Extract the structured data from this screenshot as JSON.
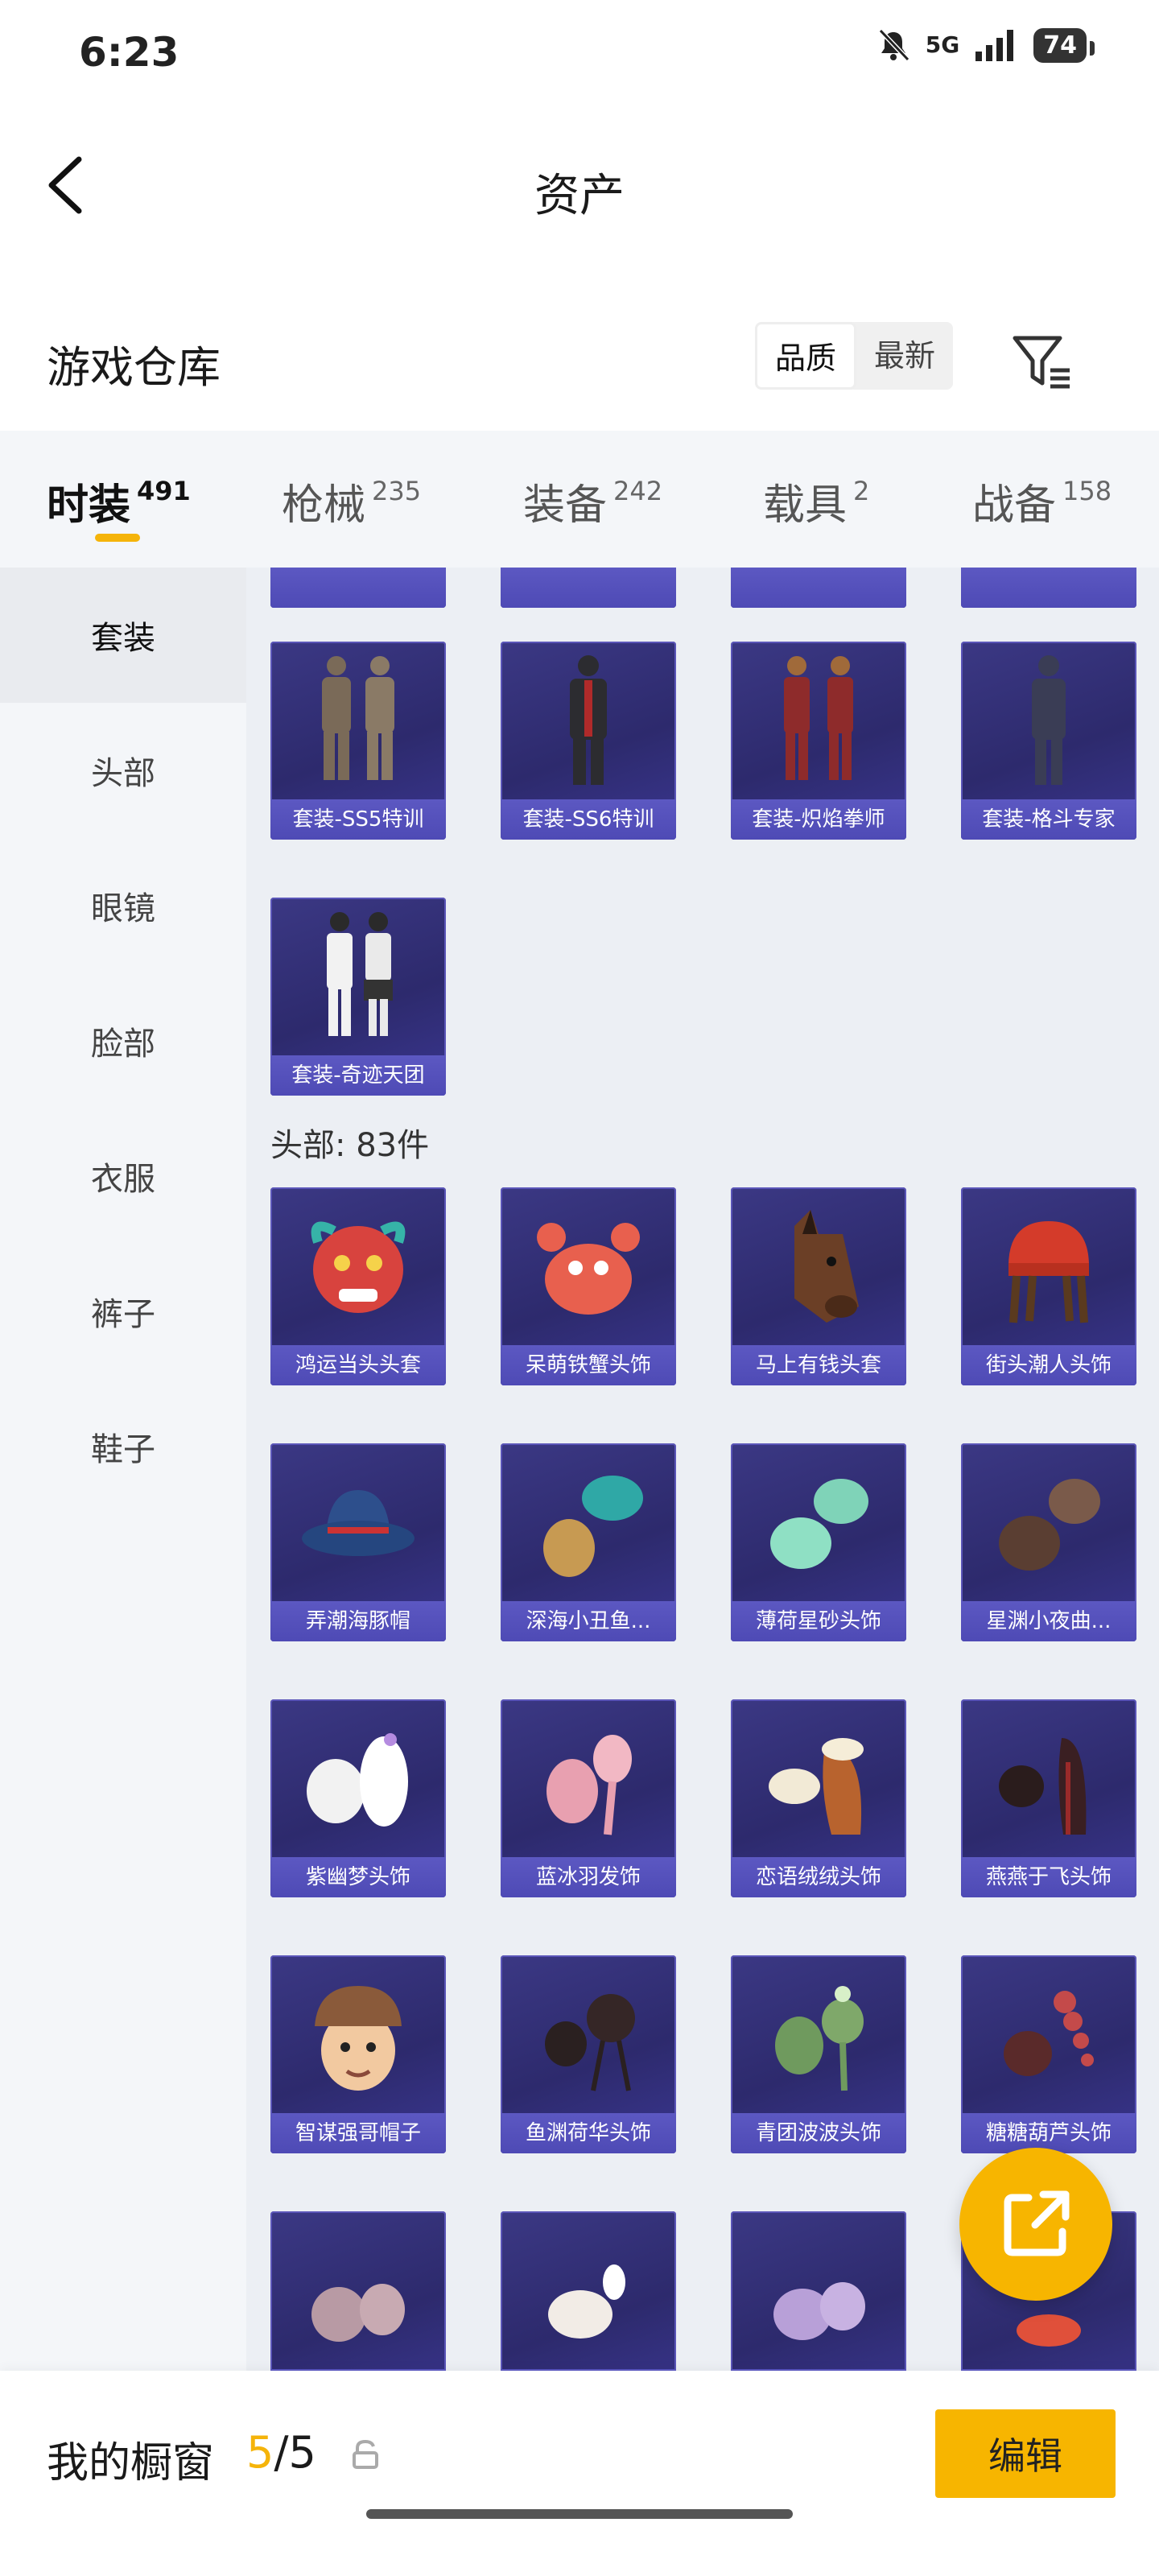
{
  "status": {
    "time": "6:23",
    "network": "5G",
    "battery": "74"
  },
  "header": {
    "title": "资产"
  },
  "warehouse": {
    "title": "游戏仓库",
    "sort_quality": "品质",
    "sort_newest": "最新"
  },
  "tabs": [
    {
      "label": "时装",
      "count": "491"
    },
    {
      "label": "枪械",
      "count": "235"
    },
    {
      "label": "装备",
      "count": "242"
    },
    {
      "label": "载具",
      "count": "2"
    },
    {
      "label": "战备",
      "count": "158"
    }
  ],
  "sidenav": [
    "套装",
    "头部",
    "眼镜",
    "脸部",
    "衣服",
    "裤子",
    "鞋子"
  ],
  "suits": [
    "套装-SS5特训",
    "套装-SS6特训",
    "套装-炽焰拳师",
    "套装-格斗专家",
    "套装-奇迹天团"
  ],
  "head_section_title": "头部: 83件",
  "head_items": [
    "鸿运当头头套",
    "呆萌铁蟹头饰",
    "马上有钱头套",
    "街头潮人头饰",
    "弄潮海豚帽",
    "深海小丑鱼...",
    "薄荷星砂头饰",
    "星渊小夜曲...",
    "紫幽梦头饰",
    "蓝冰羽发饰",
    "恋语绒绒头饰",
    "燕燕于飞头饰",
    "智谋强哥帽子",
    "鱼渊荷华头饰",
    "青团波波头饰",
    "糖糖葫芦头饰"
  ],
  "bottom": {
    "label": "我的橱窗",
    "current": "5",
    "total": "/5",
    "edit": "编辑"
  },
  "colors": {
    "accent": "#f7b500",
    "card": "#2d2a6d",
    "label": "#5652bd"
  }
}
